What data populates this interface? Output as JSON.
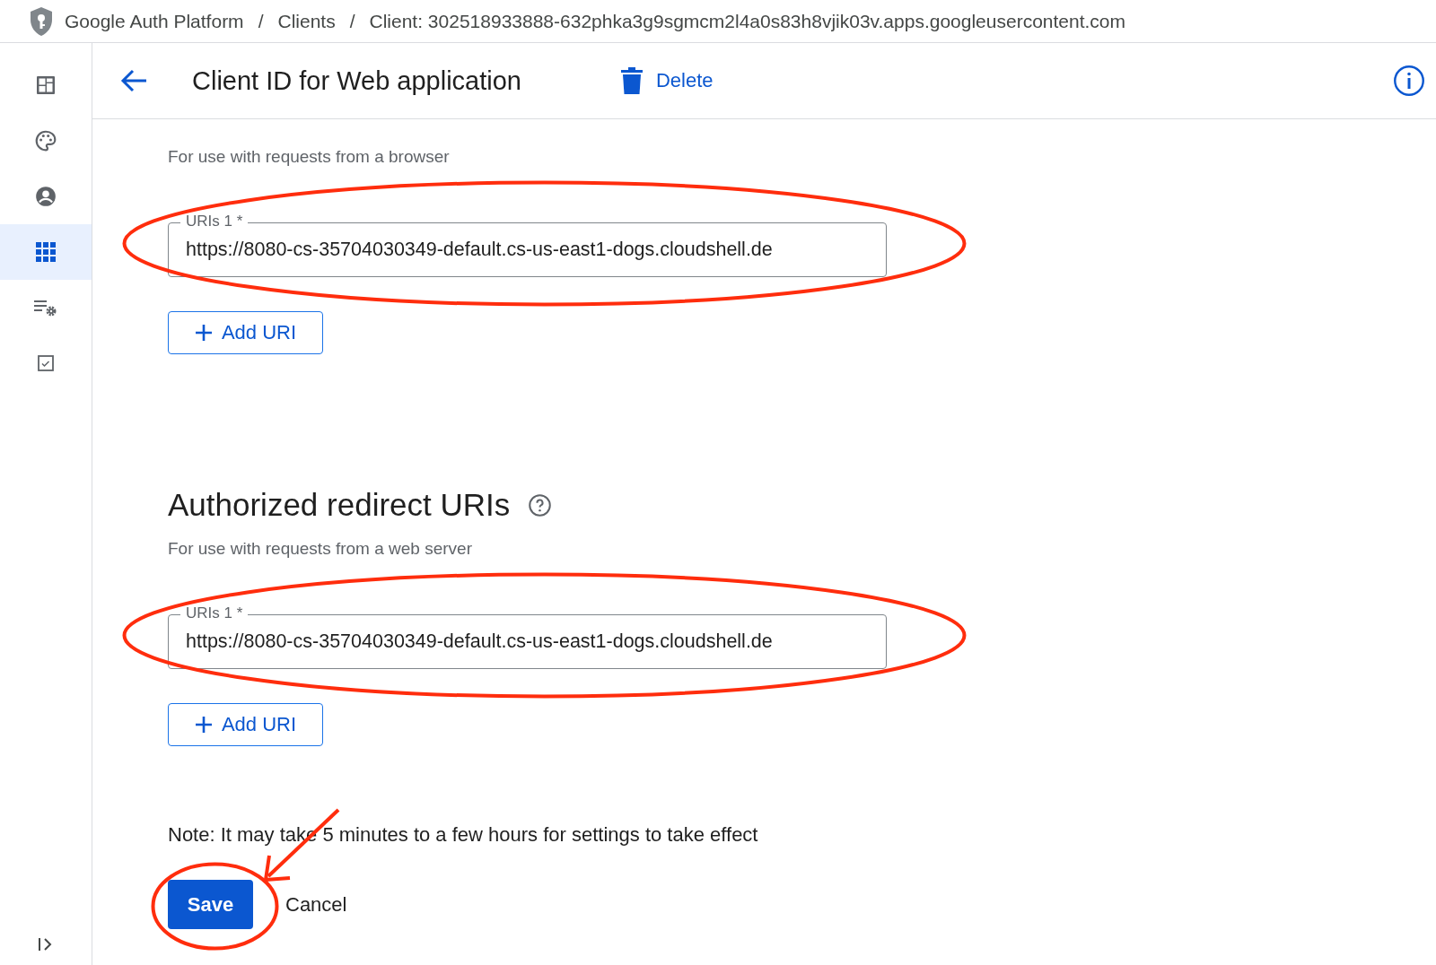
{
  "breadcrumbs": [
    "Google Auth Platform",
    "Clients",
    "Client: 302518933888-632phka3g9sgmcm2l4a0s83h8vjik03v.apps.googleusercontent.com"
  ],
  "breadcrumb_separator": "/",
  "sidebar": {
    "items": [
      {
        "selected": false
      },
      {
        "selected": false
      },
      {
        "selected": false
      },
      {
        "selected": true
      },
      {
        "selected": false
      },
      {
        "selected": false
      }
    ]
  },
  "header": {
    "title": "Client ID for Web application",
    "delete_label": "Delete"
  },
  "sections": [
    {
      "subtitle": "For use with requests from a browser",
      "field": {
        "label": "URIs 1 *",
        "value": "https://8080-cs-35704030349-default.cs-us-east1-dogs.cloudshell.de",
        "circled": true
      },
      "add_button": "Add URI"
    },
    {
      "heading": "Authorized redirect URIs",
      "subtitle": "For use with requests from a web server",
      "field": {
        "label": "URIs 1 *",
        "value": "https://8080-cs-35704030349-default.cs-us-east1-dogs.cloudshell.de",
        "circled": true
      },
      "add_button": "Add URI"
    }
  ],
  "note": "Note: It may take 5 minutes to a few hours for settings to take effect",
  "save": {
    "label": "Save",
    "circled": true,
    "arrow": true
  },
  "cancel": "Cancel"
}
